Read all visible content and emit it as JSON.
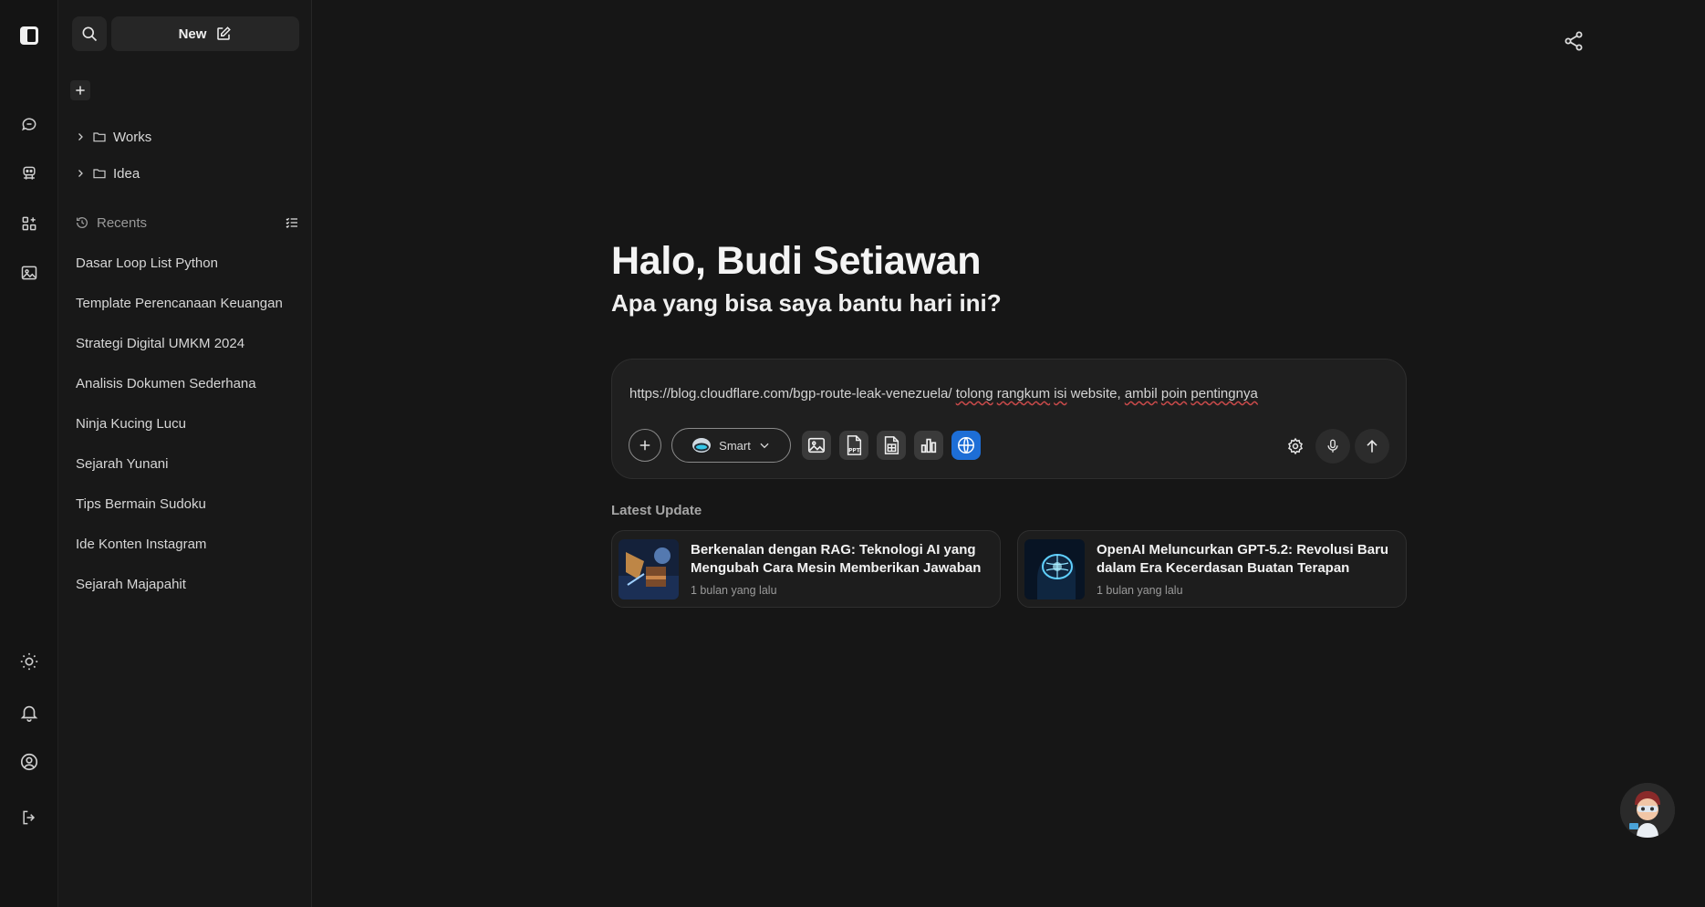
{
  "rail": {
    "icons": [
      "sidebar-toggle-icon",
      "chat-icon",
      "robot-icon",
      "apps-icon",
      "image-icon",
      "sun-icon",
      "bell-icon",
      "user-icon",
      "logout-icon"
    ]
  },
  "sidebar": {
    "new_label": "New",
    "folders": [
      {
        "label": "Works"
      },
      {
        "label": "Idea"
      }
    ],
    "recents_label": "Recents",
    "recents": [
      "Dasar Loop List Python",
      "Template Perencanaan Keuangan",
      "Strategi Digital UMKM 2024",
      "Analisis Dokumen Sederhana",
      "Ninja Kucing Lucu",
      "Sejarah Yunani",
      "Tips Bermain Sudoku",
      "Ide Konten Instagram",
      "Sejarah Majapahit"
    ]
  },
  "main": {
    "greeting": "Halo, Budi Setiawan",
    "subtitle": "Apa yang bisa saya bantu hari ini?",
    "composer": {
      "prompt_parts": {
        "p1": "https://blog.cloudflare.com/bgp-route-leak-venezuela/ ",
        "w1": "tolong",
        "s1": " ",
        "w2": "rangkum",
        "s2": " ",
        "w3": "isi",
        "p2": " website, ",
        "w4": "ambil",
        "s3": " ",
        "w5": "poin",
        "s4": " ",
        "w6": "pentingnya"
      },
      "model_label": "Smart"
    },
    "latest_label": "Latest Update",
    "cards": [
      {
        "title": "Berkenalan dengan RAG: Teknologi AI yang Mengubah Cara Mesin Memberikan Jawaban",
        "time": "1 bulan yang lalu"
      },
      {
        "title": "OpenAI Meluncurkan GPT-5.2: Revolusi Baru dalam Era Kecerdasan Buatan Terapan",
        "time": "1 bulan yang lalu"
      }
    ]
  },
  "colors": {
    "background": "#161616",
    "sidebar": "#181818",
    "accent": "#1d6ed6"
  }
}
